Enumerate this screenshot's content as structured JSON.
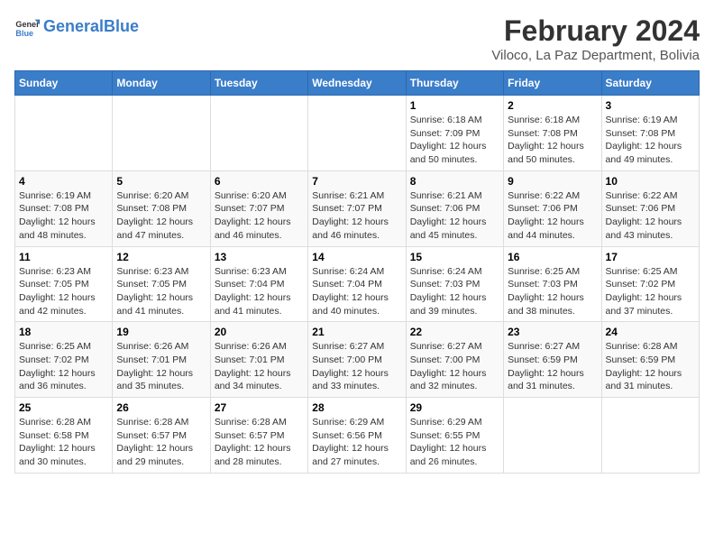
{
  "header": {
    "logo_text_general": "General",
    "logo_text_blue": "Blue",
    "month_title": "February 2024",
    "location": "Viloco, La Paz Department, Bolivia"
  },
  "weekdays": [
    "Sunday",
    "Monday",
    "Tuesday",
    "Wednesday",
    "Thursday",
    "Friday",
    "Saturday"
  ],
  "weeks": [
    [
      {
        "day": "",
        "info": ""
      },
      {
        "day": "",
        "info": ""
      },
      {
        "day": "",
        "info": ""
      },
      {
        "day": "",
        "info": ""
      },
      {
        "day": "1",
        "info": "Sunrise: 6:18 AM\nSunset: 7:09 PM\nDaylight: 12 hours\nand 50 minutes."
      },
      {
        "day": "2",
        "info": "Sunrise: 6:18 AM\nSunset: 7:08 PM\nDaylight: 12 hours\nand 50 minutes."
      },
      {
        "day": "3",
        "info": "Sunrise: 6:19 AM\nSunset: 7:08 PM\nDaylight: 12 hours\nand 49 minutes."
      }
    ],
    [
      {
        "day": "4",
        "info": "Sunrise: 6:19 AM\nSunset: 7:08 PM\nDaylight: 12 hours\nand 48 minutes."
      },
      {
        "day": "5",
        "info": "Sunrise: 6:20 AM\nSunset: 7:08 PM\nDaylight: 12 hours\nand 47 minutes."
      },
      {
        "day": "6",
        "info": "Sunrise: 6:20 AM\nSunset: 7:07 PM\nDaylight: 12 hours\nand 46 minutes."
      },
      {
        "day": "7",
        "info": "Sunrise: 6:21 AM\nSunset: 7:07 PM\nDaylight: 12 hours\nand 46 minutes."
      },
      {
        "day": "8",
        "info": "Sunrise: 6:21 AM\nSunset: 7:06 PM\nDaylight: 12 hours\nand 45 minutes."
      },
      {
        "day": "9",
        "info": "Sunrise: 6:22 AM\nSunset: 7:06 PM\nDaylight: 12 hours\nand 44 minutes."
      },
      {
        "day": "10",
        "info": "Sunrise: 6:22 AM\nSunset: 7:06 PM\nDaylight: 12 hours\nand 43 minutes."
      }
    ],
    [
      {
        "day": "11",
        "info": "Sunrise: 6:23 AM\nSunset: 7:05 PM\nDaylight: 12 hours\nand 42 minutes."
      },
      {
        "day": "12",
        "info": "Sunrise: 6:23 AM\nSunset: 7:05 PM\nDaylight: 12 hours\nand 41 minutes."
      },
      {
        "day": "13",
        "info": "Sunrise: 6:23 AM\nSunset: 7:04 PM\nDaylight: 12 hours\nand 41 minutes."
      },
      {
        "day": "14",
        "info": "Sunrise: 6:24 AM\nSunset: 7:04 PM\nDaylight: 12 hours\nand 40 minutes."
      },
      {
        "day": "15",
        "info": "Sunrise: 6:24 AM\nSunset: 7:03 PM\nDaylight: 12 hours\nand 39 minutes."
      },
      {
        "day": "16",
        "info": "Sunrise: 6:25 AM\nSunset: 7:03 PM\nDaylight: 12 hours\nand 38 minutes."
      },
      {
        "day": "17",
        "info": "Sunrise: 6:25 AM\nSunset: 7:02 PM\nDaylight: 12 hours\nand 37 minutes."
      }
    ],
    [
      {
        "day": "18",
        "info": "Sunrise: 6:25 AM\nSunset: 7:02 PM\nDaylight: 12 hours\nand 36 minutes."
      },
      {
        "day": "19",
        "info": "Sunrise: 6:26 AM\nSunset: 7:01 PM\nDaylight: 12 hours\nand 35 minutes."
      },
      {
        "day": "20",
        "info": "Sunrise: 6:26 AM\nSunset: 7:01 PM\nDaylight: 12 hours\nand 34 minutes."
      },
      {
        "day": "21",
        "info": "Sunrise: 6:27 AM\nSunset: 7:00 PM\nDaylight: 12 hours\nand 33 minutes."
      },
      {
        "day": "22",
        "info": "Sunrise: 6:27 AM\nSunset: 7:00 PM\nDaylight: 12 hours\nand 32 minutes."
      },
      {
        "day": "23",
        "info": "Sunrise: 6:27 AM\nSunset: 6:59 PM\nDaylight: 12 hours\nand 31 minutes."
      },
      {
        "day": "24",
        "info": "Sunrise: 6:28 AM\nSunset: 6:59 PM\nDaylight: 12 hours\nand 31 minutes."
      }
    ],
    [
      {
        "day": "25",
        "info": "Sunrise: 6:28 AM\nSunset: 6:58 PM\nDaylight: 12 hours\nand 30 minutes."
      },
      {
        "day": "26",
        "info": "Sunrise: 6:28 AM\nSunset: 6:57 PM\nDaylight: 12 hours\nand 29 minutes."
      },
      {
        "day": "27",
        "info": "Sunrise: 6:28 AM\nSunset: 6:57 PM\nDaylight: 12 hours\nand 28 minutes."
      },
      {
        "day": "28",
        "info": "Sunrise: 6:29 AM\nSunset: 6:56 PM\nDaylight: 12 hours\nand 27 minutes."
      },
      {
        "day": "29",
        "info": "Sunrise: 6:29 AM\nSunset: 6:55 PM\nDaylight: 12 hours\nand 26 minutes."
      },
      {
        "day": "",
        "info": ""
      },
      {
        "day": "",
        "info": ""
      }
    ]
  ]
}
